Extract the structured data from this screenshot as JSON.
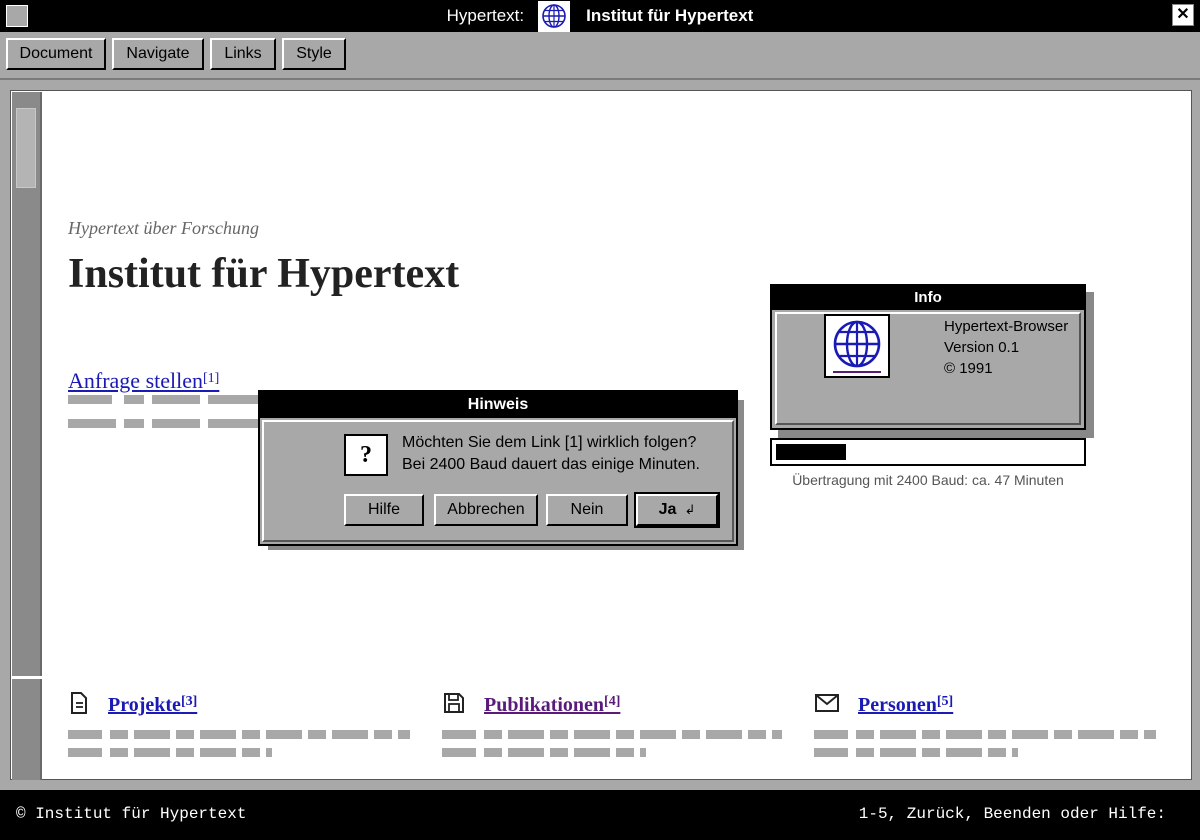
{
  "window": {
    "title_prefix": "Hypertext:",
    "title": "Institut für Hypertext",
    "close_symbol": "✕"
  },
  "menu": [
    "Document",
    "Navigate",
    "Links",
    "Style"
  ],
  "page": {
    "subheading": "Hypertext über Forschung",
    "heading": "Institut für Hypertext",
    "request_link": "Anfrage stellen",
    "request_ref": "[1]"
  },
  "info_panel": {
    "title": "Info",
    "line1": "Hypertext-Browser",
    "line2": "Version 0.1",
    "line3": "© 1991",
    "progress_fraction": 0.23,
    "progress_label": "Übertragung mit 2400 Baud: ca. 47 Minuten"
  },
  "columns": [
    {
      "icon": "document-icon",
      "label": "Projekte",
      "ref": "[3]",
      "visited": false
    },
    {
      "icon": "floppy-disk-icon",
      "label": "Publikationen",
      "ref": "[4]",
      "visited": true
    },
    {
      "icon": "envelope-icon",
      "label": "Personen",
      "ref": "[5]",
      "visited": false
    }
  ],
  "dialog": {
    "title": "Hinweis",
    "icon_symbol": "?",
    "message_line1": "Möchten Sie dem Link [1] wirklich folgen?",
    "message_line2": "Bei 2400 Baud dauert das einige Minuten.",
    "buttons": {
      "help": "Hilfe",
      "cancel": "Abbrechen",
      "no": "Nein",
      "yes": "Ja",
      "yes_symbol": "↲"
    }
  },
  "status": {
    "left": "© Institut für Hypertext",
    "right": "1-5, Zurück, Beenden oder Hilfe:"
  },
  "colors": {
    "chrome_grey": "#a8a8a8",
    "link_blue": "#1a1ab4",
    "visited_purple": "#5a1a7a"
  }
}
